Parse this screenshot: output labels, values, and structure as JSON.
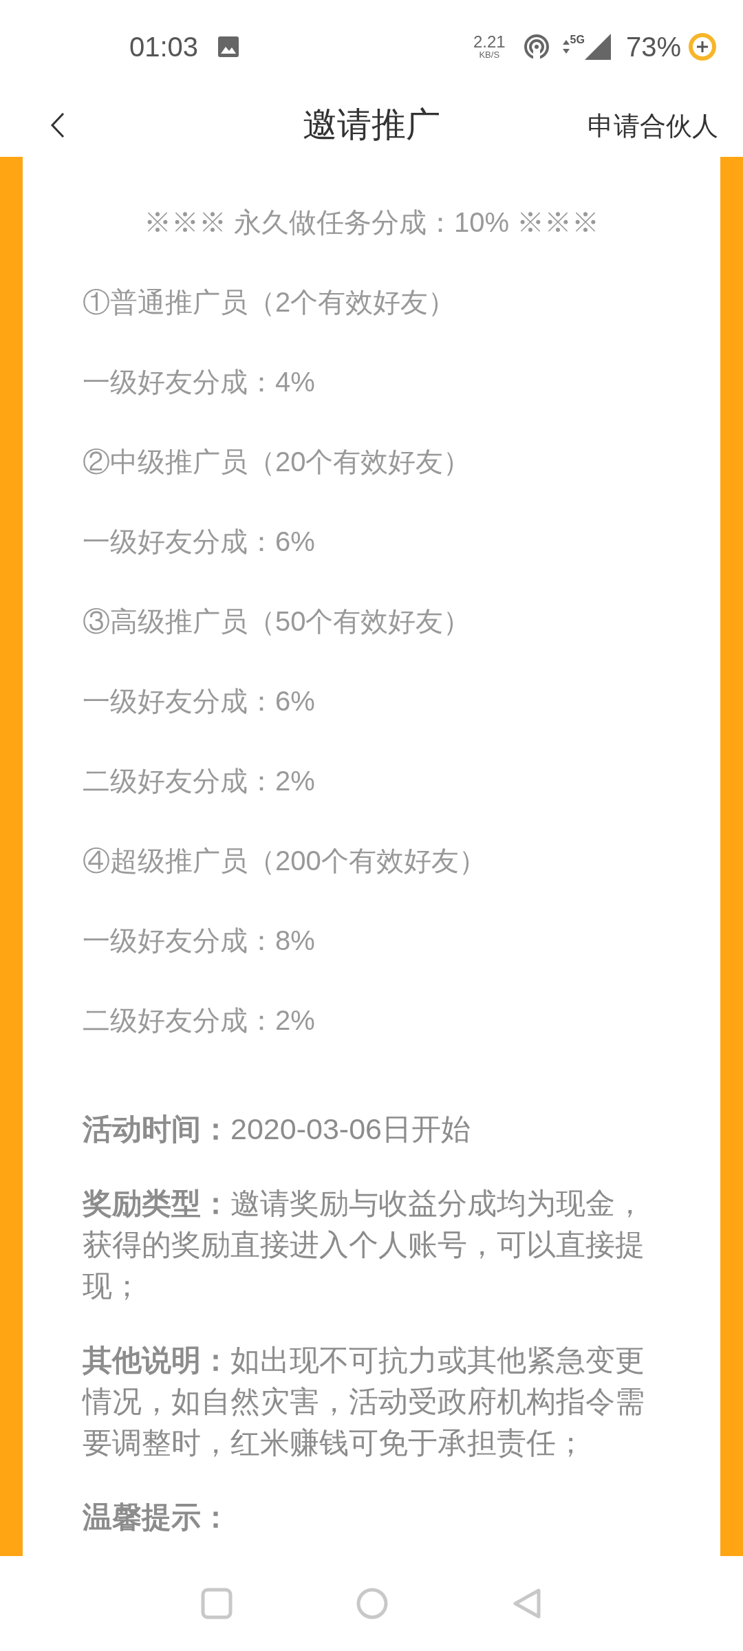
{
  "status_bar": {
    "time": "01:03",
    "speed": "2.21",
    "speed_unit": "KB/S",
    "network": "5G",
    "battery": "73%"
  },
  "header": {
    "title": "邀请推广",
    "action": "申请合伙人"
  },
  "banner": "※※※ 永久做任务分成：10% ※※※",
  "tiers": [
    "①普通推广员（2个有效好友）",
    "一级好友分成：4%",
    "②中级推广员（20个有效好友）",
    "一级好友分成：6%",
    "③高级推广员（50个有效好友）",
    "一级好友分成：6%",
    "二级好友分成：2%",
    "④超级推广员（200个有效好友）",
    "一级好友分成：8%",
    "二级好友分成：2%"
  ],
  "notes": [
    "**活动时间：**2020-03-06日开始",
    "**奖励类型：**邀请奖励与收益分成均为现金，获得的奖励直接进入个人账号，可以直接提现；",
    "**其他说明：**如出现不可抗力或其他紧急变更情况，如自然灾害，活动受政府机构指令需要调整时，红米赚钱可免于承担责任；",
    "**温馨提示：**"
  ]
}
